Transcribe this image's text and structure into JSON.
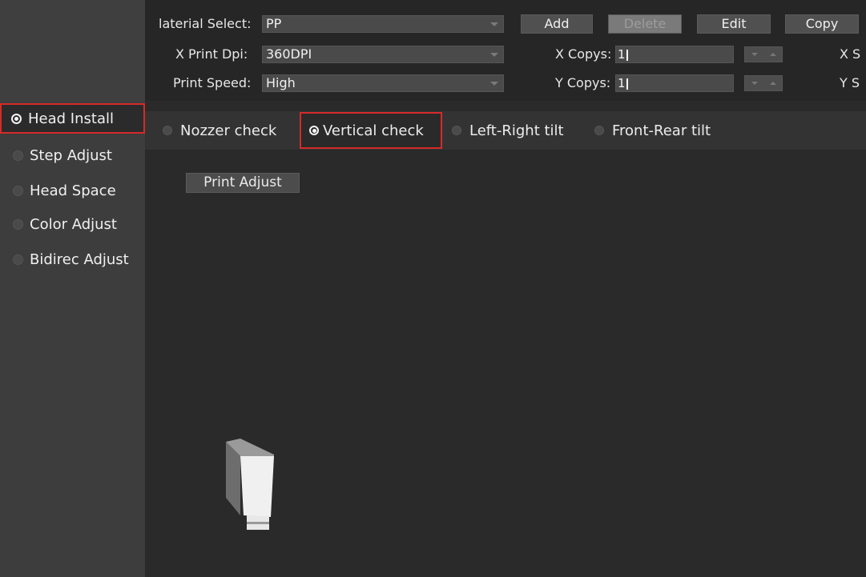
{
  "topbar": {
    "material_label": "laterial Select:",
    "material_value": "PP",
    "xdpi_label": "X Print Dpi:",
    "xdpi_value": "360DPI",
    "speed_label": "Print Speed:",
    "speed_value": "High",
    "add_label": "Add",
    "delete_label": "Delete",
    "edit_label": "Edit",
    "copy_label": "Copy",
    "xcopys_label": "X Copys:",
    "xcopys_value": "1",
    "ycopys_label": "Y Copys:",
    "ycopys_value": "1",
    "xs_label": "X S",
    "ys_label": "Y S"
  },
  "sidebar": {
    "items": [
      {
        "label": "Head Install"
      },
      {
        "label": "Step Adjust"
      },
      {
        "label": "Head Space"
      },
      {
        "label": "Color Adjust"
      },
      {
        "label": "Bidirec Adjust"
      }
    ]
  },
  "tabs": [
    {
      "label": "Nozzer check"
    },
    {
      "label": "Vertical check"
    },
    {
      "label": "Left-Right tilt"
    },
    {
      "label": "Front-Rear tilt"
    }
  ],
  "main": {
    "print_adjust_label": "Print Adjust"
  },
  "colors": {
    "highlight": "#d62a2a",
    "background": "#2a2a2a",
    "sidebar": "#3d3d3d"
  },
  "icons": [
    "radio-selected-icon",
    "radio-unselected-icon",
    "dropdown-arrow-icon",
    "spinner-down-icon",
    "spinner-up-icon",
    "print-head-graphic"
  ]
}
